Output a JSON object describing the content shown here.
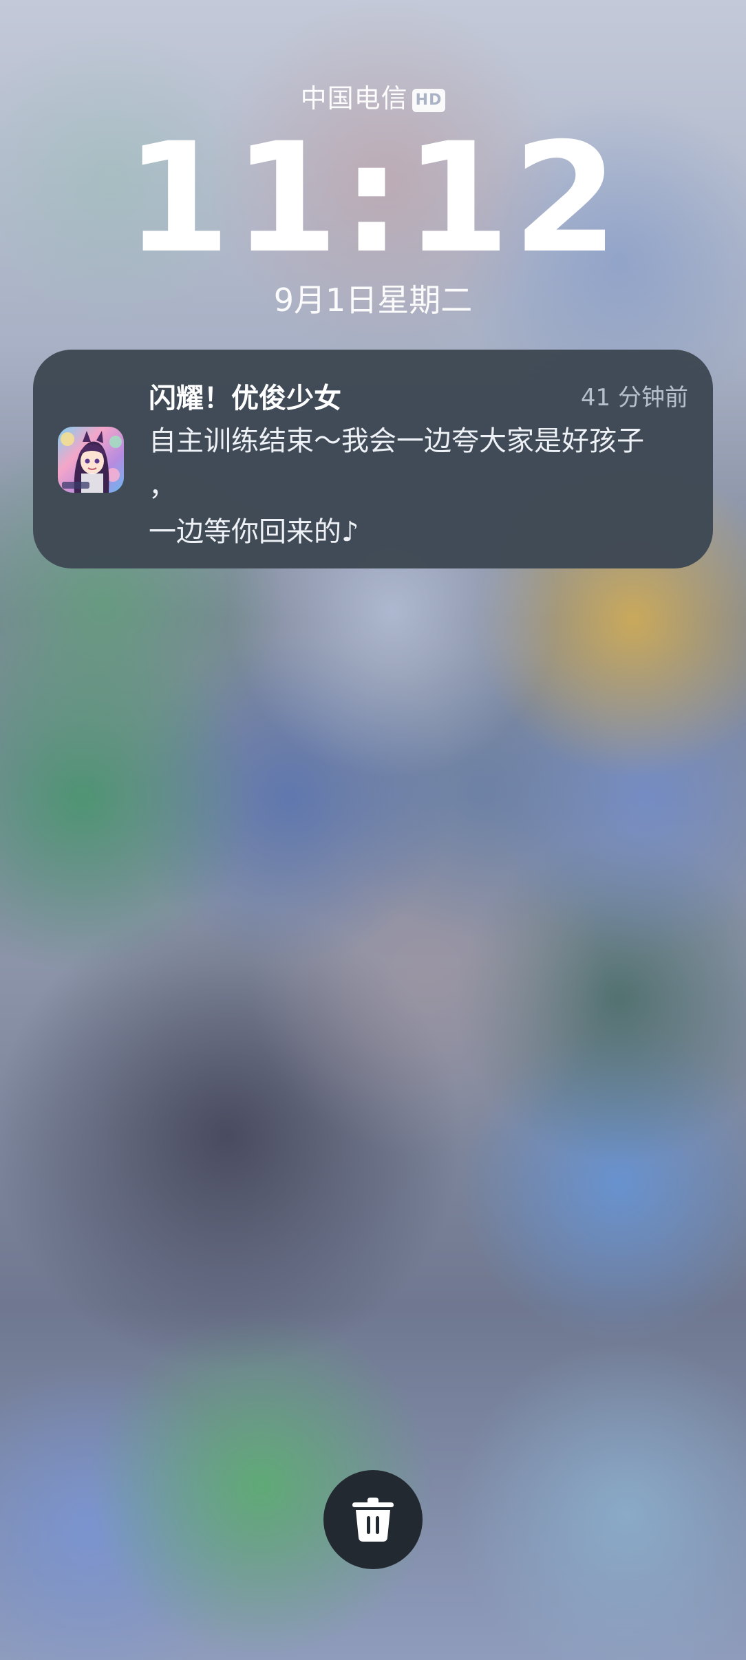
{
  "status": {
    "carrier": "中国电信",
    "carrier_badge": "HD"
  },
  "lockscreen": {
    "time": "11:12",
    "date": "9月1日星期二"
  },
  "notification": {
    "app_name": "闪耀！优俊少女",
    "time_ago": "41 分钟前",
    "body": "自主训练结束～我会一边夸大家是好孩子\n，\n一边等你回来的♪",
    "icon": "uma-musume-app-icon"
  },
  "actions": {
    "clear_icon": "trash-icon"
  },
  "colors": {
    "notification_bg": "#3e4854",
    "trash_button_bg": "#232930"
  }
}
